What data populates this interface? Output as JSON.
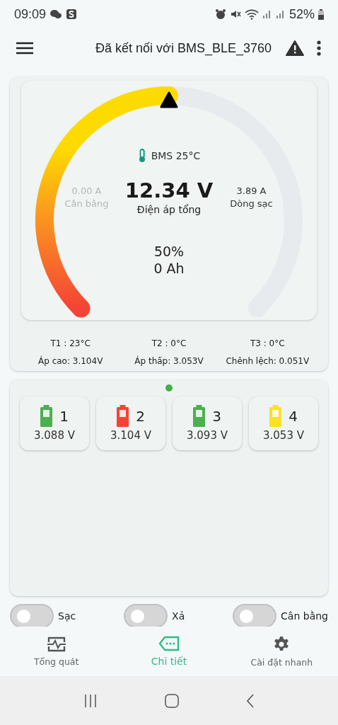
{
  "status_bar": {
    "time": "09:09",
    "battery": "52%"
  },
  "app_bar": {
    "title": "Đã kết nối với BMS_BLE_3760"
  },
  "gauge": {
    "temperature": "BMS 25°C",
    "left_value": "0.00 A",
    "left_label": "Cân bằng",
    "main_value": "12.34 V",
    "main_label": "Điện áp tổng",
    "right_value": "3.89 A",
    "right_label": "Dòng sạc",
    "percent": "50%",
    "capacity": "0 Ah"
  },
  "stats": [
    "T1 : 23°C",
    "T2 : 0°C",
    "T3 : 0°C",
    "Áp cao: 3.104V",
    "Áp thấp: 3.053V",
    "Chênh lệch: 0.051V"
  ],
  "cells": [
    {
      "number": "1",
      "voltage": "3.088 V",
      "color": "#4caf50"
    },
    {
      "number": "2",
      "voltage": "3.104 V",
      "color": "#f44336"
    },
    {
      "number": "3",
      "voltage": "3.093 V",
      "color": "#4caf50"
    },
    {
      "number": "4",
      "voltage": "3.053 V",
      "color": "#fbe024"
    }
  ],
  "toggles": [
    {
      "label": "Sạc",
      "on": false
    },
    {
      "label": "Xả",
      "on": false
    },
    {
      "label": "Cân bằng",
      "on": false
    }
  ],
  "tabs": [
    {
      "label": "Tổng quát",
      "selected": false
    },
    {
      "label": "Chi tiết",
      "selected": true
    },
    {
      "label": "Cài đặt nhanh",
      "selected": false
    }
  ]
}
